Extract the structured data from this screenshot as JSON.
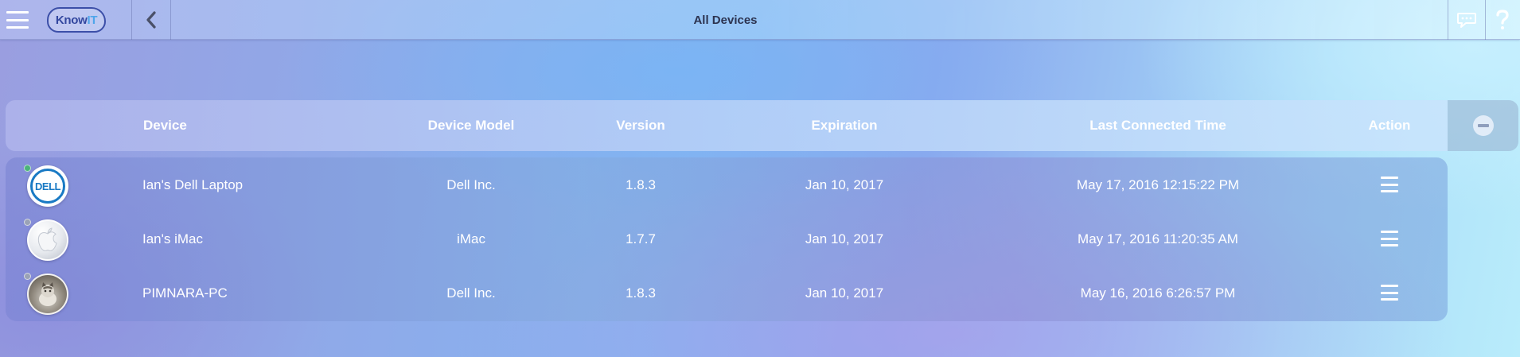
{
  "app": {
    "logo_text_main": "Know",
    "logo_text_accent": "IT",
    "title": "All Devices"
  },
  "icons": {
    "menu": "hamburger-menu-icon",
    "back": "chevron-left-icon",
    "chat": "chat-bubble-icon",
    "help": "question-mark-icon",
    "collapse": "minus-circle-icon",
    "row_action": "hamburger-action-icon"
  },
  "table": {
    "columns": {
      "device": "Device",
      "model": "Device Model",
      "version": "Version",
      "expiration": "Expiration",
      "last_connected": "Last Connected Time",
      "action": "Action"
    },
    "rows": [
      {
        "avatar": "dell-logo",
        "status": "online",
        "device": "Ian's Dell Laptop",
        "model": "Dell Inc.",
        "version": "1.8.3",
        "expiration": "Jan 10, 2017",
        "last_connected": "May 17, 2016 12:15:22 PM"
      },
      {
        "avatar": "apple-logo",
        "status": "offline",
        "device": "Ian's iMac",
        "model": "iMac",
        "version": "1.7.7",
        "expiration": "Jan 10, 2017",
        "last_connected": "May 17, 2016 11:20:35 AM"
      },
      {
        "avatar": "pet-photo",
        "status": "offline",
        "device": "PIMNARA-PC",
        "model": "Dell Inc.",
        "version": "1.8.3",
        "expiration": "Jan 10, 2017",
        "last_connected": "May 16, 2016 6:26:57 PM"
      }
    ]
  },
  "colors": {
    "logo_primary": "#33479f",
    "logo_accent": "#4fa6ea",
    "online_status": "#4bb37a",
    "offline_status": "#9aa2b6",
    "dell_blue": "#1a7ac4"
  }
}
